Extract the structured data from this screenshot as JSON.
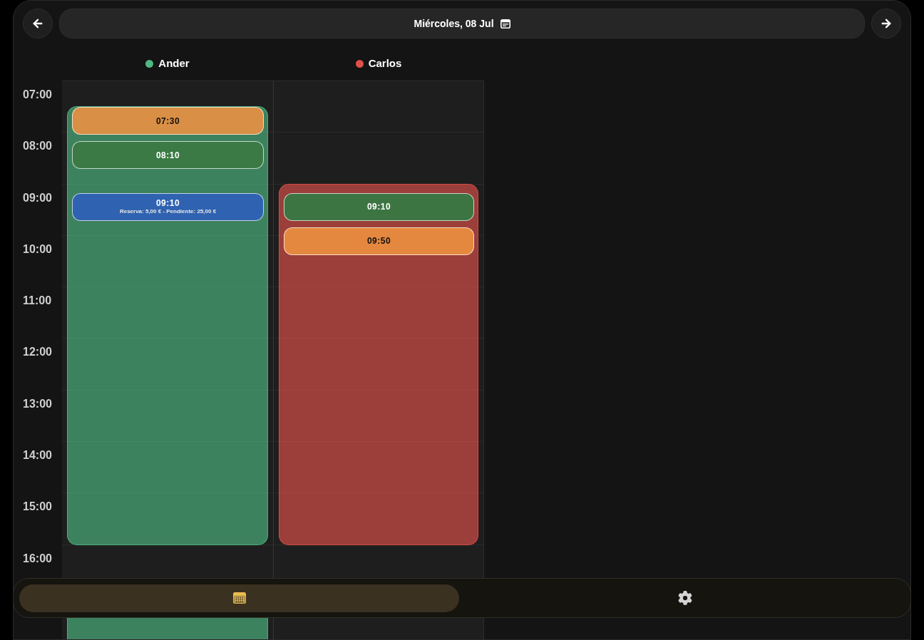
{
  "header": {
    "date": "Miércoles, 08 Jul"
  },
  "hours": [
    "07:00",
    "08:00",
    "09:00",
    "10:00",
    "11:00",
    "12:00",
    "13:00",
    "14:00",
    "15:00",
    "16:00"
  ],
  "staff": [
    {
      "name": "Ander",
      "color": "#4fb883",
      "appointments": [
        {
          "time": "07:30",
          "color": "#d98f45"
        },
        {
          "time": "08:10",
          "color": "#3b7a45"
        },
        {
          "time": "09:10",
          "color": "#2f62b0",
          "note": "Reserva: 5,00 € - Pendiente: 25,00 €"
        }
      ]
    },
    {
      "name": "Carlos",
      "color": "#e0504a",
      "appointments": [
        {
          "time": "09:10",
          "color": "#3d7542"
        },
        {
          "time": "09:50",
          "color": "#e5883f"
        }
      ]
    }
  ],
  "nav": [
    {
      "kind": "calendar",
      "selected": true
    },
    {
      "kind": "settings",
      "selected": false
    }
  ]
}
